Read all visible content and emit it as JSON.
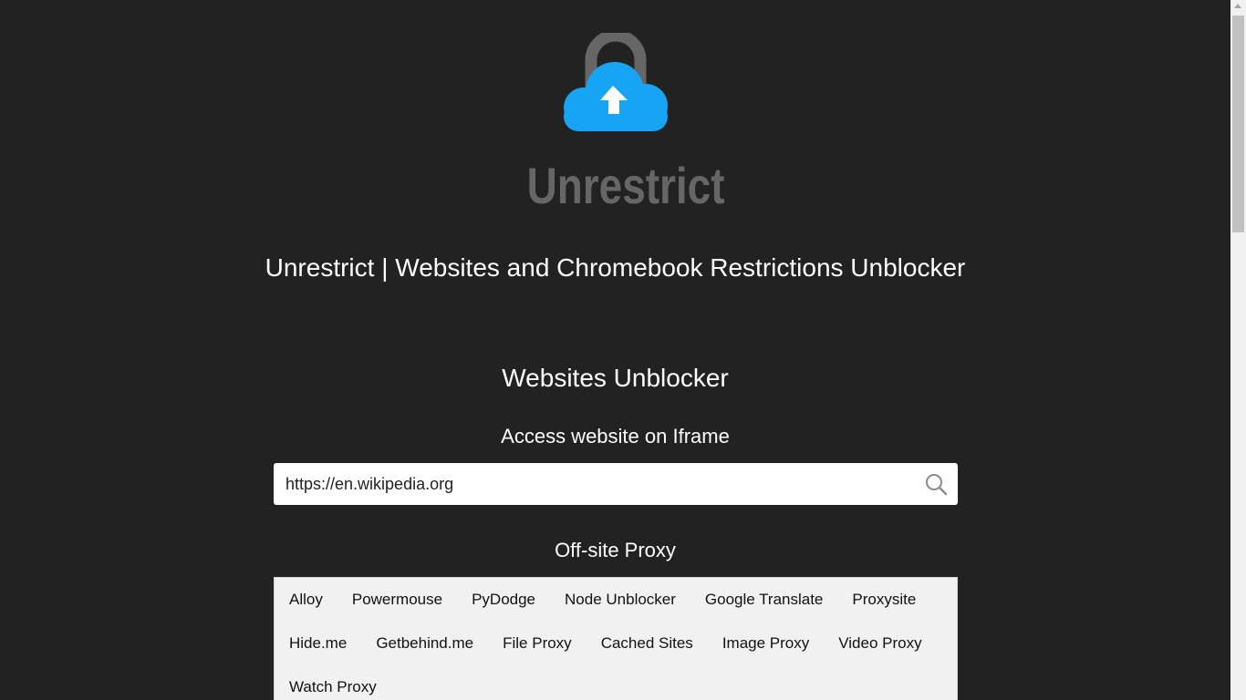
{
  "logo": {
    "text": "Unrestrict",
    "icon": "cloud-lock-upload-icon",
    "colors": {
      "cloud": "#1aa3f5",
      "lock": "#666666",
      "arrow": "#ffffff"
    }
  },
  "header": {
    "site_title": "Unrestrict | Websites and Chromebook Restrictions Unblocker"
  },
  "unblocker": {
    "title": "Websites Unblocker",
    "subtitle": "Access website on Iframe",
    "url_value": "https://en.wikipedia.org",
    "search_icon": "search-icon"
  },
  "proxy": {
    "title": "Off-site Proxy",
    "links": [
      "Alloy",
      "Powermouse",
      "PyDodge",
      "Node Unblocker",
      "Google Translate",
      "Proxysite",
      "Hide.me",
      "Getbehind.me",
      "File Proxy",
      "Cached Sites",
      "Image Proxy",
      "Video Proxy",
      "Watch Proxy"
    ]
  },
  "theme": {
    "background": "#222222",
    "text": "#ffffff",
    "panel": "#f1f1f1"
  }
}
